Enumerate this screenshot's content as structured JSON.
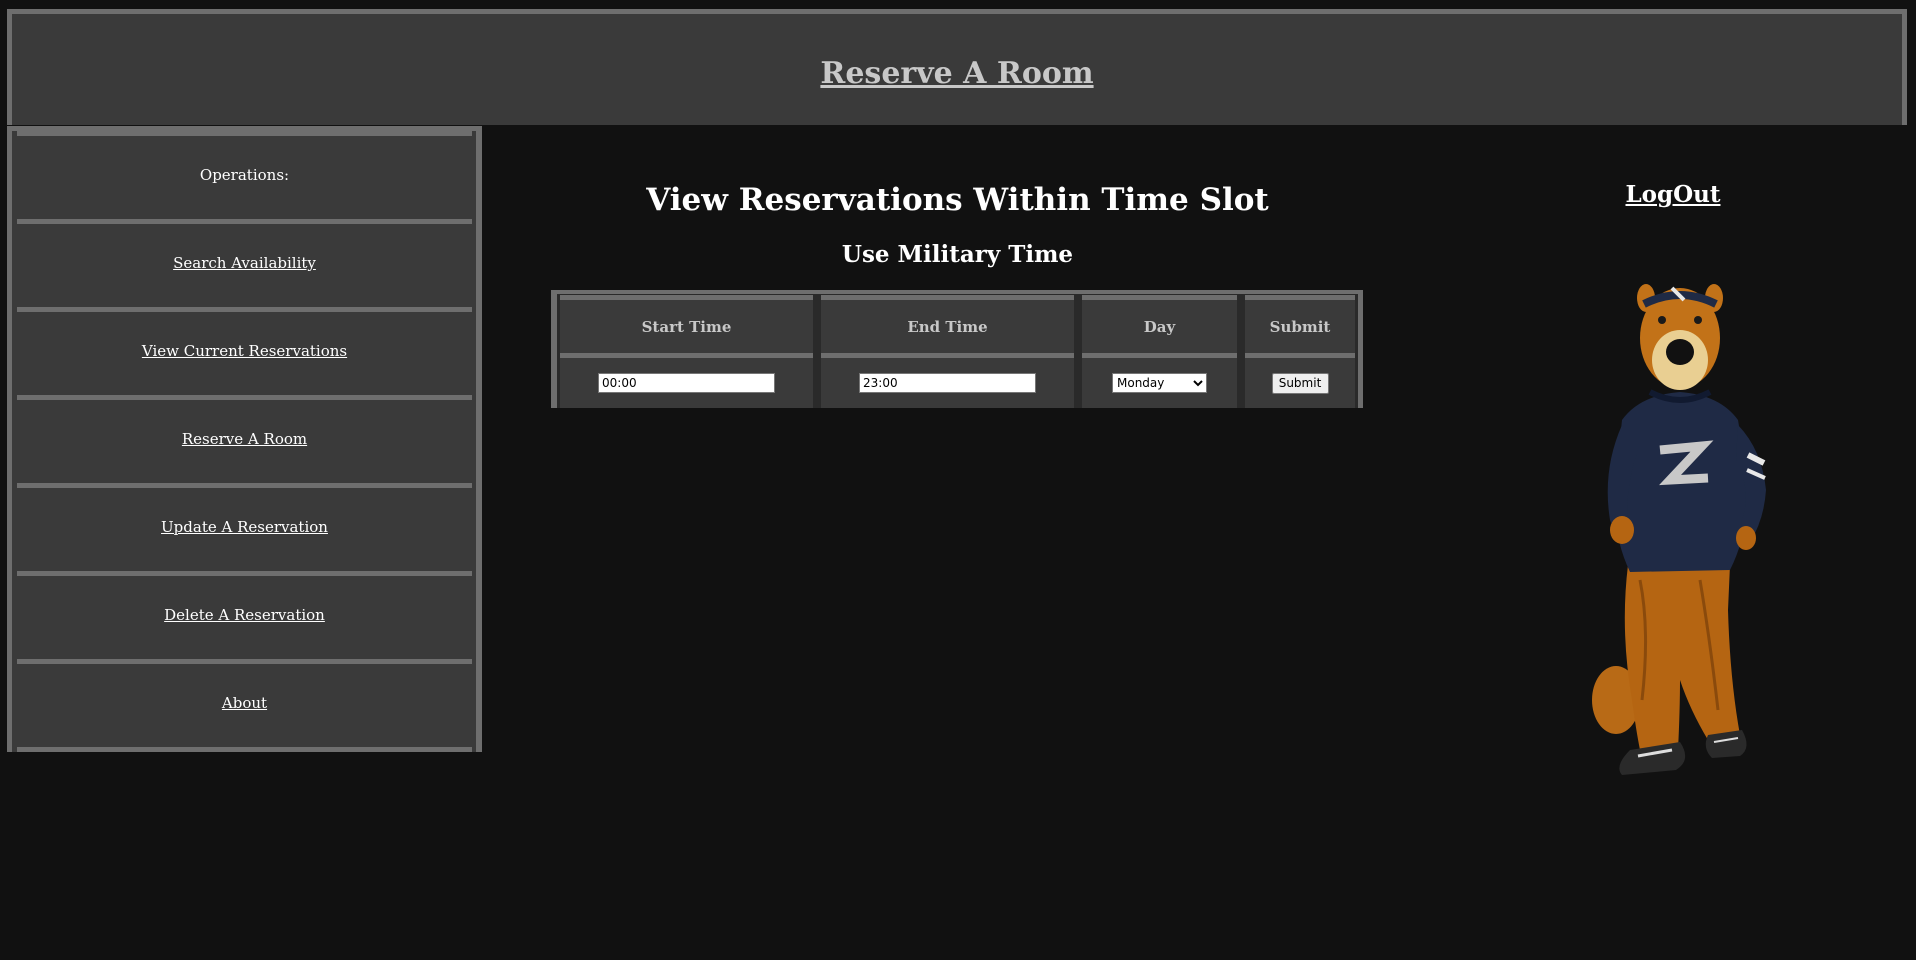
{
  "header": {
    "title": "Reserve A Room"
  },
  "sidebar": {
    "items": [
      {
        "label": "Operations:",
        "link": false
      },
      {
        "label": "Search Availability",
        "link": true
      },
      {
        "label": "View Current Reservations",
        "link": true
      },
      {
        "label": "Reserve A Room",
        "link": true
      },
      {
        "label": "Update A Reservation",
        "link": true
      },
      {
        "label": "Delete A Reservation",
        "link": true
      },
      {
        "label": "About",
        "link": true
      }
    ]
  },
  "main": {
    "title": "View Reservations Within Time Slot",
    "subtitle": "Use Military Time"
  },
  "form": {
    "headers": {
      "start": "Start Time",
      "end": "End Time",
      "day": "Day",
      "submit": "Submit"
    },
    "start_time": "00:00",
    "end_time": "23:00",
    "day_selected": "Monday",
    "submit_label": "Submit"
  },
  "logout": {
    "label": "LogOut"
  },
  "mascot": {
    "icon": "mascot-zippy-image"
  },
  "colors": {
    "page_bg": "#111111",
    "panel_bg": "#3a3a3a",
    "border": "#6e6e6e",
    "header_text": "#c8c8c8",
    "text": "#ffffff"
  }
}
